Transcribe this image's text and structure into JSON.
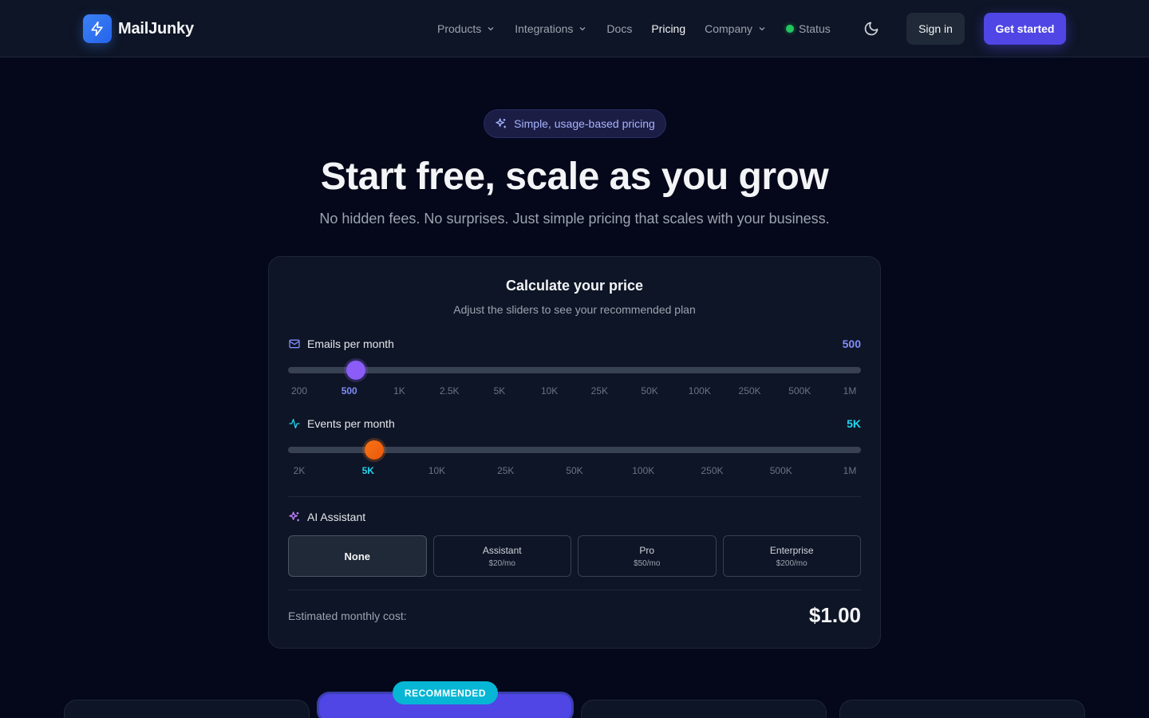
{
  "brand": {
    "name": "MailJunky"
  },
  "nav": {
    "items": [
      {
        "label": "Products",
        "dropdown": true,
        "active": false
      },
      {
        "label": "Integrations",
        "dropdown": true,
        "active": false
      },
      {
        "label": "Docs",
        "dropdown": false,
        "active": false
      },
      {
        "label": "Pricing",
        "dropdown": false,
        "active": true
      },
      {
        "label": "Company",
        "dropdown": true,
        "active": false
      }
    ],
    "status_label": "Status",
    "signin_label": "Sign in",
    "cta_label": "Get started"
  },
  "hero": {
    "pill": "Simple, usage-based pricing",
    "title": "Start free, scale as you grow",
    "subtitle": "No hidden fees. No surprises. Just simple pricing that scales with your business."
  },
  "calculator": {
    "title": "Calculate your price",
    "subtitle": "Adjust the sliders to see your recommended plan",
    "emails": {
      "label": "Emails per month",
      "value": "500",
      "ticks": [
        "200",
        "500",
        "1K",
        "2.5K",
        "5K",
        "10K",
        "25K",
        "50K",
        "100K",
        "250K",
        "500K",
        "1M"
      ],
      "selected_index": 1
    },
    "events": {
      "label": "Events per month",
      "value": "5K",
      "ticks": [
        "2K",
        "5K",
        "10K",
        "25K",
        "50K",
        "100K",
        "250K",
        "500K",
        "1M"
      ],
      "selected_index": 1
    },
    "ai": {
      "label": "AI Assistant",
      "options": [
        {
          "name": "None",
          "price": ""
        },
        {
          "name": "Assistant",
          "price": "$20/mo"
        },
        {
          "name": "Pro",
          "price": "$50/mo"
        },
        {
          "name": "Enterprise",
          "price": "$200/mo"
        }
      ],
      "selected_index": 0
    },
    "cost_label": "Estimated monthly cost:",
    "cost_value": "$1.00"
  },
  "plans": {
    "recommended_badge": "RECOMMENDED"
  },
  "colors": {
    "accent": "#4f46e5",
    "email_slider": "#8b5cf6",
    "event_slider": "#f97316",
    "event_value": "#22d3ee",
    "status": "#22c55e"
  }
}
